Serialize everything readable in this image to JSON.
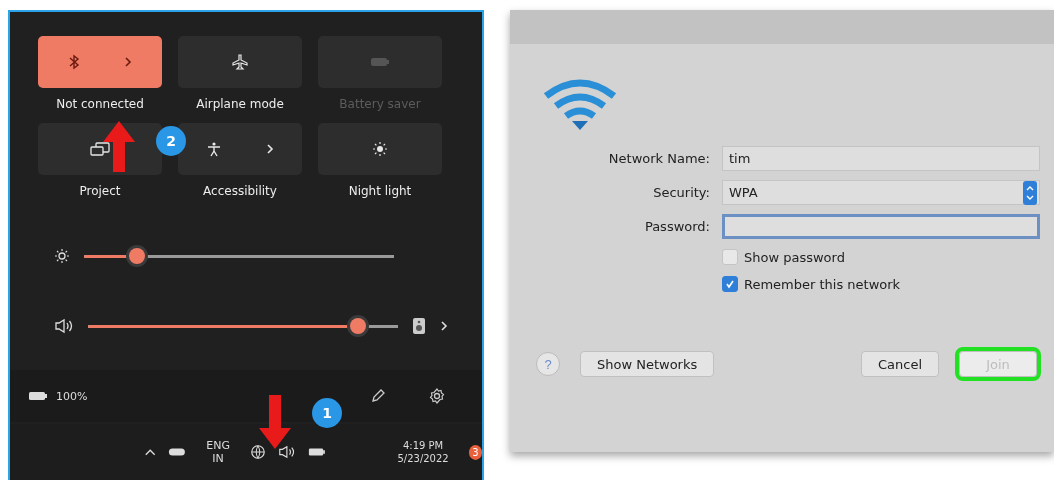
{
  "quick_settings": {
    "tiles": [
      {
        "kind": "bluetooth",
        "label": "Not connected",
        "on": true,
        "disabled": false,
        "expandable": true
      },
      {
        "kind": "airplane",
        "label": "Airplane mode",
        "on": false,
        "disabled": false,
        "expandable": false
      },
      {
        "kind": "battery_saver",
        "label": "Battery saver",
        "on": false,
        "disabled": true,
        "expandable": false
      },
      {
        "kind": "project",
        "label": "Project",
        "on": false,
        "disabled": false,
        "expandable": false
      },
      {
        "kind": "accessibility",
        "label": "Accessibility",
        "on": false,
        "disabled": false,
        "expandable": true
      },
      {
        "kind": "night_light",
        "label": "Night light",
        "on": false,
        "disabled": false,
        "expandable": false
      }
    ],
    "sliders": [
      {
        "kind": "brightness",
        "level": 0.17
      },
      {
        "kind": "volume",
        "level": 0.87
      }
    ],
    "battery": "100%",
    "annotations": [
      {
        "kind": "up",
        "label": "2"
      },
      {
        "kind": "down",
        "label": "1"
      }
    ]
  },
  "taskbar": {
    "language": "ENG",
    "region": "IN",
    "time": "4:19 PM",
    "date": "5/23/2022",
    "notification_count": "3"
  },
  "join_dialog": {
    "fields": [
      {
        "kind": "text",
        "label": "Network Name:",
        "value": "tim"
      },
      {
        "kind": "select",
        "label": "Security:",
        "value": "WPA"
      },
      {
        "kind": "password",
        "label": "Password:",
        "focused": true
      }
    ],
    "checkboxes": [
      {
        "label": "Show password",
        "checked": false
      },
      {
        "label": "Remember this network",
        "checked": true
      }
    ],
    "help": "?",
    "buttons": [
      {
        "kind": "secondary",
        "label": "Show Networks",
        "disabled": false,
        "highlighted": false
      },
      {
        "kind": "secondary",
        "label": "Cancel",
        "disabled": false,
        "highlighted": false
      },
      {
        "kind": "primary",
        "label": "Join",
        "disabled": true,
        "highlighted": true
      }
    ]
  }
}
